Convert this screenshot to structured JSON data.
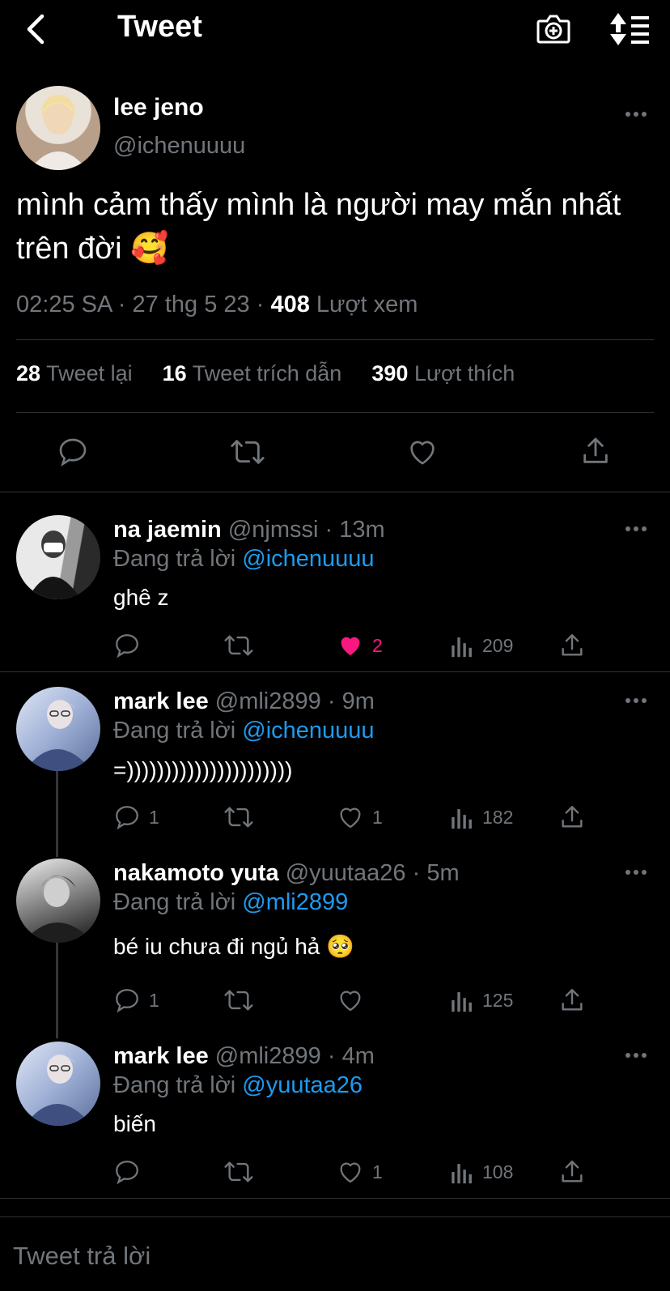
{
  "header": {
    "title": "Tweet",
    "icons": [
      "back-arrow-icon",
      "camera-plus-icon",
      "sort-icon"
    ]
  },
  "main_tweet": {
    "name": "lee jeno",
    "handle": "@ichenuuuu",
    "text": "mình cảm thấy mình là người may mắn nhất trên đời",
    "emoji": "🥰",
    "time": "02:25 SA",
    "date": "27 thg 5 23",
    "views": "408",
    "views_label": "Lượt xem",
    "retweets": "28",
    "retweets_label": "Tweet lại",
    "quotes": "16",
    "quotes_label": "Tweet trích dẫn",
    "likes": "390",
    "likes_label": "Lượt thích",
    "sep": "·"
  },
  "replies": [
    {
      "name": "na jaemin",
      "handle": "@njmssi",
      "time": "13m",
      "replying_label": "Đang trả lời",
      "replying_to": "@ichenuuuu",
      "text": "ghê z",
      "replies": "",
      "likes": "2",
      "liked": true,
      "views": "209"
    },
    {
      "name": "mark lee",
      "handle": "@mli2899",
      "time": "9m",
      "replying_label": "Đang trả lời",
      "replying_to": "@ichenuuuu",
      "text": "=))))))))))))))))))))))",
      "replies": "1",
      "likes": "1",
      "liked": false,
      "views": "182"
    },
    {
      "name": "nakamoto yuta",
      "handle": "@yuutaa26",
      "time": "5m",
      "replying_label": "Đang trả lời",
      "replying_to": "@mli2899",
      "text": "bé iu chưa đi ngủ hả",
      "emoji": "🥺",
      "replies": "1",
      "likes": "",
      "liked": false,
      "views": "125"
    },
    {
      "name": "mark lee",
      "handle": "@mli2899",
      "time": "4m",
      "replying_label": "Đang trả lời",
      "replying_to": "@yuutaa26",
      "text": "biến",
      "replies": "",
      "likes": "1",
      "liked": false,
      "views": "108"
    }
  ],
  "composer": {
    "placeholder": "Tweet trả lời"
  },
  "colors": {
    "background": "#000000",
    "accent": "#1d9bf0",
    "like": "#f91880",
    "muted": "#71767b"
  }
}
